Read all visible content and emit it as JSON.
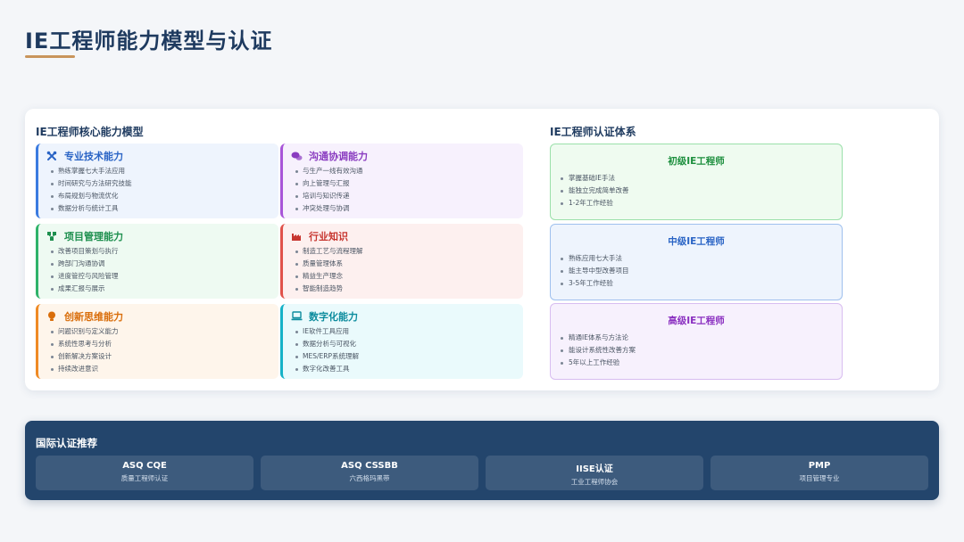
{
  "page": {
    "title": "IE工程师能力模型与认证"
  },
  "model": {
    "heading": "IE工程师核心能力模型",
    "cards": [
      {
        "title": "专业技术能力",
        "icon": "tools-icon",
        "color": "#3b7be0",
        "items": [
          "熟练掌握七大手法应用",
          "时间研究与方法研究技能",
          "布局规划与物流优化",
          "数据分析与统计工具"
        ]
      },
      {
        "title": "沟通协调能力",
        "icon": "chat-bubbles-icon",
        "color": "#a855d8",
        "items": [
          "与生产一线有效沟通",
          "向上管理与汇报",
          "培训与知识传递",
          "冲突处理与协调"
        ]
      },
      {
        "title": "项目管理能力",
        "icon": "project-tree-icon",
        "color": "#2fb36a",
        "items": [
          "改善项目策划与执行",
          "跨部门沟通协调",
          "进度管控与风险管理",
          "成果汇报与展示"
        ]
      },
      {
        "title": "行业知识",
        "icon": "factory-icon",
        "color": "#e0524a",
        "items": [
          "制造工艺与流程理解",
          "质量管理体系",
          "精益生产理念",
          "智能制造趋势"
        ]
      },
      {
        "title": "创新思维能力",
        "icon": "lightbulb-icon",
        "color": "#ef8a24",
        "items": [
          "问题识别与定义能力",
          "系统性思考与分析",
          "创新解决方案设计",
          "持续改进意识"
        ]
      },
      {
        "title": "数字化能力",
        "icon": "laptop-icon",
        "color": "#16b2c7",
        "items": [
          "IE软件工具应用",
          "数据分析与可视化",
          "MES/ERP系统理解",
          "数字化改善工具"
        ]
      }
    ]
  },
  "certification": {
    "heading": "IE工程师认证体系",
    "levels": [
      {
        "title": "初级IE工程师",
        "color": "#1d8f3e",
        "items": [
          "掌握基础IE手法",
          "能独立完成简单改善",
          "1-2年工作经验"
        ]
      },
      {
        "title": "中级IE工程师",
        "color": "#2a64c5",
        "items": [
          "熟练应用七大手法",
          "能主导中型改善项目",
          "3-5年工作经验"
        ]
      },
      {
        "title": "高级IE工程师",
        "color": "#8a2fc0",
        "items": [
          "精通IE体系与方法论",
          "能设计系统性改善方案",
          "5年以上工作经验"
        ]
      }
    ]
  },
  "international": {
    "heading": "国际认证推荐",
    "items": [
      {
        "name": "ASQ CQE",
        "desc": "质量工程师认证"
      },
      {
        "name": "ASQ CSSBB",
        "desc": "六西格玛黑带"
      },
      {
        "name": "IISE认证",
        "desc": "工业工程师协会"
      },
      {
        "name": "PMP",
        "desc": "项目管理专业"
      }
    ]
  }
}
